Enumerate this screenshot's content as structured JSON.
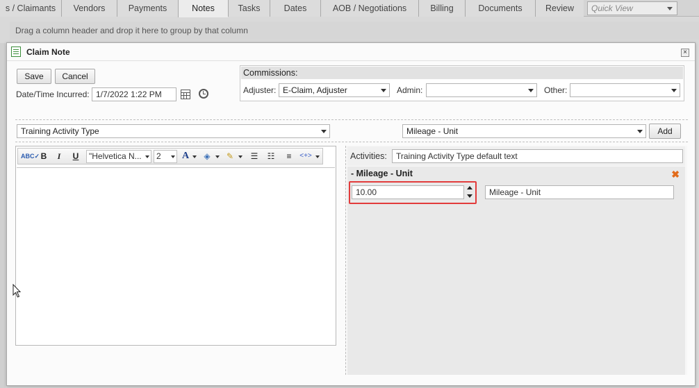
{
  "tabs": [
    {
      "label": "s / Claimants",
      "active": false
    },
    {
      "label": "Vendors",
      "active": false
    },
    {
      "label": "Payments",
      "active": false
    },
    {
      "label": "Notes",
      "active": true
    },
    {
      "label": "Tasks",
      "active": false
    },
    {
      "label": "Dates",
      "active": false
    },
    {
      "label": "AOB / Negotiations",
      "active": false
    },
    {
      "label": "Billing",
      "active": false
    },
    {
      "label": "Documents",
      "active": false
    },
    {
      "label": "Review",
      "active": false
    }
  ],
  "quick_view": {
    "placeholder": "Quick View"
  },
  "group_bar": {
    "text": "Drag a column header and drop it here to group by that column"
  },
  "dialog": {
    "title": "Claim Note",
    "save_label": "Save",
    "cancel_label": "Cancel",
    "datetime_label": "Date/Time Incurred:",
    "datetime_value": "1/7/2022 1:22 PM",
    "commissions": {
      "header": "Commissions:",
      "adjuster_label": "Adjuster:",
      "adjuster_value": "E-Claim, Adjuster",
      "admin_label": "Admin:",
      "admin_value": "",
      "other_label": "Other:",
      "other_value": ""
    },
    "activity_type_value": "Training Activity Type",
    "mileage_select_value": "Mileage - Unit",
    "add_label": "Add",
    "editor": {
      "font_name": "\"Helvetica N...",
      "font_size": "2"
    },
    "activities": {
      "label": "Activities:",
      "value": "Training Activity Type default text",
      "item_title": "- Mileage - Unit",
      "quantity_value": "10.00",
      "unit_value": "Mileage - Unit"
    }
  },
  "colors": {
    "highlight": "#e23c3c",
    "remove_icon": "#e26b1a"
  }
}
